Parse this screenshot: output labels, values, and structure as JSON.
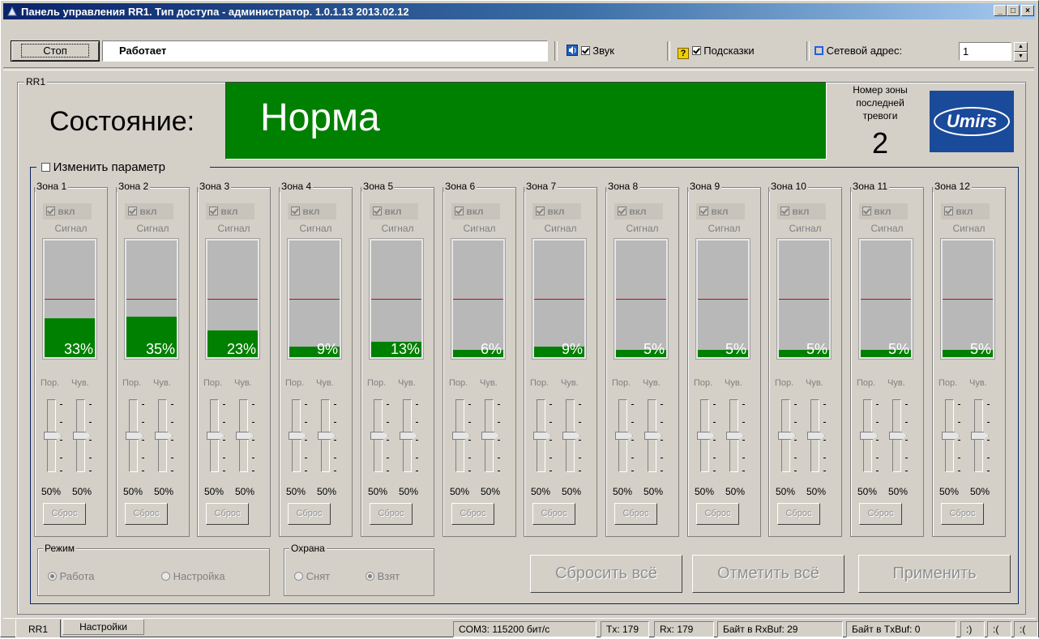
{
  "window": {
    "title": "Панель управления RR1. Тип доступа - администратор. 1.0.1.13 2013.02.12",
    "min_glyph": "_",
    "max_glyph": "□",
    "close_glyph": "×"
  },
  "toolbar": {
    "stop_label": "Стоп",
    "status_value": "Работает",
    "sound_label": "Звук",
    "sound_checked": true,
    "hints_label": "Подсказки",
    "hints_icon_glyph": "?",
    "hints_checked": true,
    "network_label": "Сетевой адрес:",
    "network_value": "1"
  },
  "panel": {
    "group_label": "RR1",
    "state_label": "Состояние:",
    "state_value": "Норма",
    "last_alarm_label_1": "Номер зоны",
    "last_alarm_label_2": "последней",
    "last_alarm_label_3": "тревоги",
    "last_alarm_value": "2",
    "logo_text": "Umirs",
    "change_param_label": "Изменить параметр",
    "change_param_checked": false
  },
  "zone_common": {
    "vkl_label": "вкл",
    "signal_label": "Сигнал",
    "por_label": "Пор.",
    "chuv_label": "Чув.",
    "reset_label": "Сброс",
    "threshold_level": 0.5
  },
  "zones": [
    {
      "label": "Зона 1",
      "percent": "33%",
      "level": 0.33,
      "por": "50%",
      "chuv": "50%"
    },
    {
      "label": "Зона 2",
      "percent": "35%",
      "level": 0.35,
      "por": "50%",
      "chuv": "50%"
    },
    {
      "label": "Зона 3",
      "percent": "23%",
      "level": 0.23,
      "por": "50%",
      "chuv": "50%"
    },
    {
      "label": "Зона 4",
      "percent": "9%",
      "level": 0.09,
      "por": "50%",
      "chuv": "50%"
    },
    {
      "label": "Зона 5",
      "percent": "13%",
      "level": 0.13,
      "por": "50%",
      "chuv": "50%"
    },
    {
      "label": "Зона 6",
      "percent": "6%",
      "level": 0.06,
      "por": "50%",
      "chuv": "50%"
    },
    {
      "label": "Зона 7",
      "percent": "9%",
      "level": 0.09,
      "por": "50%",
      "chuv": "50%"
    },
    {
      "label": "Зона 8",
      "percent": "5%",
      "level": 0.05,
      "por": "50%",
      "chuv": "50%"
    },
    {
      "label": "Зона 9",
      "percent": "5%",
      "level": 0.05,
      "por": "50%",
      "chuv": "50%"
    },
    {
      "label": "Зона 10",
      "percent": "5%",
      "level": 0.05,
      "por": "50%",
      "chuv": "50%"
    },
    {
      "label": "Зона 11",
      "percent": "5%",
      "level": 0.05,
      "por": "50%",
      "chuv": "50%"
    },
    {
      "label": "Зона 12",
      "percent": "5%",
      "level": 0.05,
      "por": "50%",
      "chuv": "50%"
    }
  ],
  "mode": {
    "label": "Режим",
    "work_label": "Работа",
    "setup_label": "Настройка",
    "selected": "work"
  },
  "guard": {
    "label": "Охрана",
    "off_label": "Снят",
    "on_label": "Взят",
    "selected": "on"
  },
  "actions": {
    "reset_all": "Сбросить всё",
    "mark_all": "Отметить всё",
    "apply": "Применить"
  },
  "tabs": [
    {
      "label": "RR1"
    },
    {
      "label": "Настройки"
    }
  ],
  "statusbar": {
    "port": "COM3: 115200 бит/с",
    "tx": "Tx: 179",
    "rx": "Rx: 179",
    "rxbuf": "Байт в RxBuf: 29",
    "txbuf": "Байт в TxBuf: 0",
    "s1": ":)",
    "s2": ":(",
    "s3": ":("
  },
  "colors": {
    "state_bg": "#008000",
    "bar_fill": "#008000",
    "threshold": "#e00000",
    "logo_bg": "#1a4a9a"
  }
}
